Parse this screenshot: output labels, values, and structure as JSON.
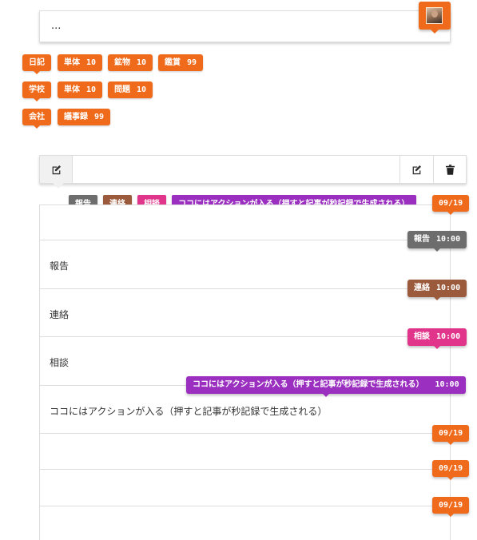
{
  "header": {
    "input_text": "...",
    "avatar": "user-avatar-photo"
  },
  "tag_groups": [
    {
      "tags": [
        {
          "label": "日記",
          "count": ""
        },
        {
          "label": "単体",
          "count": "10"
        },
        {
          "label": "鉱物",
          "count": "10"
        },
        {
          "label": "鑑賞",
          "count": "99"
        }
      ]
    },
    {
      "tags": [
        {
          "label": "学校",
          "count": ""
        },
        {
          "label": "単体",
          "count": "10"
        },
        {
          "label": "問題",
          "count": "10"
        }
      ]
    },
    {
      "tags": [
        {
          "label": "会社",
          "count": ""
        },
        {
          "label": "議事録",
          "count": "99"
        }
      ]
    }
  ],
  "editor": {
    "left_icon": "edit-icon",
    "right_icons": [
      "edit-icon",
      "trash-icon"
    ]
  },
  "categories": [
    {
      "label": "報告",
      "color": "#6d6d6d"
    },
    {
      "label": "連絡",
      "color": "#9c5a3c"
    },
    {
      "label": "相談",
      "color": "#e0358b"
    },
    {
      "label": "ココにはアクションが入る（押すと記事が秒記録で生成される）",
      "color": "#9b30c0"
    }
  ],
  "entries": [
    {
      "date": "09/19",
      "badge_label": "",
      "badge_time": "",
      "text": ""
    },
    {
      "date": "",
      "badge_label": "報告",
      "badge_time": "10:00",
      "badge_color": "#6d6d6d",
      "text": "報告"
    },
    {
      "date": "",
      "badge_label": "連絡",
      "badge_time": "10:00",
      "badge_color": "#9c5a3c",
      "text": "連絡"
    },
    {
      "date": "",
      "badge_label": "相談",
      "badge_time": "10:00",
      "badge_color": "#e0358b",
      "text": "相談"
    },
    {
      "date": "",
      "badge_label": "ココにはアクションが入る（押すと記事が秒記録で生成される）",
      "badge_time": "10:00",
      "badge_color": "#9b30c0",
      "text": "ココにはアクションが入る（押すと記事が秒記録で生成される）"
    },
    {
      "date": "09/19",
      "text": ""
    },
    {
      "date": "09/19",
      "text": ""
    },
    {
      "date": "09/19",
      "text": ""
    }
  ],
  "colors": {
    "accent": "#ef6a1a",
    "report": "#6d6d6d",
    "contact": "#9c5a3c",
    "consult": "#e0358b",
    "action": "#9b30c0"
  }
}
